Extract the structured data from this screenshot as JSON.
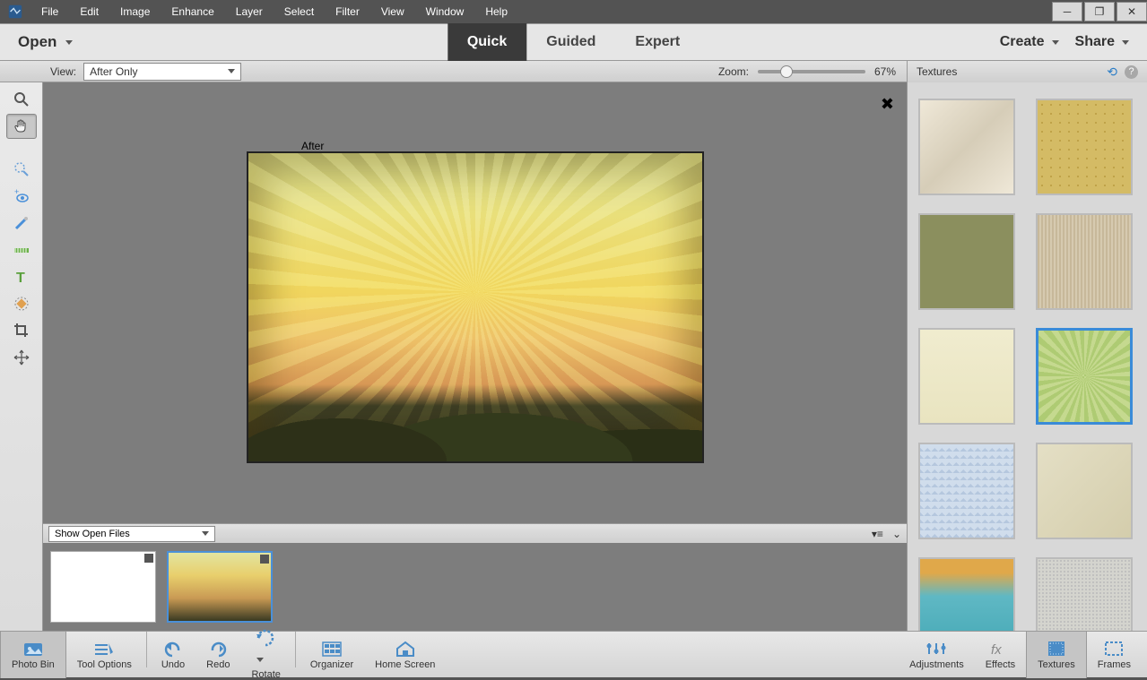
{
  "menu": {
    "items": [
      "File",
      "Edit",
      "Image",
      "Enhance",
      "Layer",
      "Select",
      "Filter",
      "View",
      "Window",
      "Help"
    ]
  },
  "actionbar": {
    "open": "Open",
    "modes": [
      "Quick",
      "Guided",
      "Expert"
    ],
    "active_mode": "Quick",
    "create": "Create",
    "share": "Share"
  },
  "viewbar": {
    "view_label": "View:",
    "view_value": "After Only",
    "zoom_label": "Zoom:",
    "zoom_value": "67%"
  },
  "panel": {
    "title": "Textures"
  },
  "canvas": {
    "after_label": "After"
  },
  "bin": {
    "select_value": "Show Open Files"
  },
  "tools": {
    "zoom": "zoom-tool",
    "hand": "hand-tool",
    "quicksel": "quick-selection-tool",
    "eye": "redeye-tool",
    "whiten": "whiten-tool",
    "straighten": "straighten-tool",
    "text": "text-tool",
    "spot": "spot-heal-tool",
    "crop": "crop-tool",
    "move": "move-tool"
  },
  "textures": [
    {
      "name": "peeling-paint",
      "selected": false
    },
    {
      "name": "gold-dots",
      "selected": false
    },
    {
      "name": "olive-canvas",
      "selected": false
    },
    {
      "name": "tan-fiber",
      "selected": false
    },
    {
      "name": "cream-linen",
      "selected": false
    },
    {
      "name": "green-sunburst",
      "selected": true
    },
    {
      "name": "blue-weave",
      "selected": false
    },
    {
      "name": "beige-scratch",
      "selected": false
    },
    {
      "name": "teal-paint",
      "selected": false
    },
    {
      "name": "silver-emboss",
      "selected": false
    }
  ],
  "bottombar": {
    "left": [
      {
        "name": "photo-bin",
        "label": "Photo Bin"
      },
      {
        "name": "tool-options",
        "label": "Tool Options"
      },
      {
        "name": "undo",
        "label": "Undo"
      },
      {
        "name": "redo",
        "label": "Redo"
      },
      {
        "name": "rotate",
        "label": "Rotate"
      },
      {
        "name": "organizer",
        "label": "Organizer"
      },
      {
        "name": "home-screen",
        "label": "Home Screen"
      }
    ],
    "right": [
      {
        "name": "adjustments",
        "label": "Adjustments"
      },
      {
        "name": "effects",
        "label": "Effects"
      },
      {
        "name": "textures",
        "label": "Textures"
      },
      {
        "name": "frames",
        "label": "Frames"
      }
    ],
    "active_left": "photo-bin",
    "active_right": "textures"
  }
}
